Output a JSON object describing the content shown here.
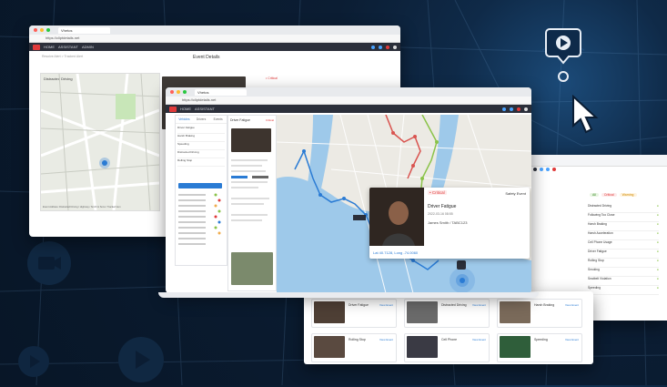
{
  "browser": {
    "tab_title": "Vhetos",
    "url": "https://cliptdetails.net",
    "nav_items": [
      "HOME",
      "ASSISTANT",
      "ADMIN"
    ]
  },
  "back_window": {
    "page_title": "Event Details",
    "breadcrumb": "Resolve Alert > Tracked Alert",
    "map_title": "Distracted Driving",
    "map_caption": "Event Address: Distracted Driving / Highway / Smith & Sons / Tracked item",
    "badge": "• Critical"
  },
  "main_window": {
    "tab_title": "Vhetos",
    "url": "https://cliptdetails.net",
    "sidebar_tabs": [
      "Vehicles",
      "Drivers",
      "Events"
    ],
    "driver_panel_title": "Driver Fatigue",
    "driver_panel_badge": "Critical",
    "sidebar_rows": [
      "Driver Fatigue",
      "Harsh Braking",
      "Speeding",
      "Distracted Driving",
      "Rolling Stop"
    ],
    "popup": {
      "severity": "• Critical",
      "type": "Safety Event",
      "title": "Driver Fatigue",
      "date": "2022-03-16 08:55",
      "driver": "James Smith / TABC123",
      "coords": "Lat 40.7128, Long -74.0060"
    }
  },
  "right_window": {
    "list_items": [
      "Distracted Driving",
      "Following Too Close",
      "Harsh Braking",
      "Harsh Acceleration",
      "Cell Phone Usage",
      "Driver Fatigue",
      "Rolling Stop",
      "Smoking",
      "Seatbelt Violation",
      "Speeding"
    ],
    "filters": [
      "All",
      "Critical",
      "Warning"
    ]
  },
  "bottom_window": {
    "cards": [
      {
        "title": "Driver Fatigue",
        "action": "View Event"
      },
      {
        "title": "Distracted Driving",
        "action": "View Event"
      },
      {
        "title": "Harsh Braking",
        "action": "View Event"
      },
      {
        "title": "Rolling Stop",
        "action": "View Event"
      },
      {
        "title": "Cell Phone",
        "action": "View Event"
      },
      {
        "title": "Speeding",
        "action": "View Event"
      }
    ]
  },
  "colors": {
    "background": "#0b1d33",
    "brand_red": "#e03a3a",
    "critical": "#e03a3a",
    "link_blue": "#2a7bd4",
    "route_blue": "#2a7bd4",
    "route_green": "#8bc34a",
    "route_red": "#d9534f"
  },
  "icons": [
    "play-pin-icon",
    "cursor-icon",
    "camera-icon",
    "play-icon",
    "pin-icon"
  ]
}
